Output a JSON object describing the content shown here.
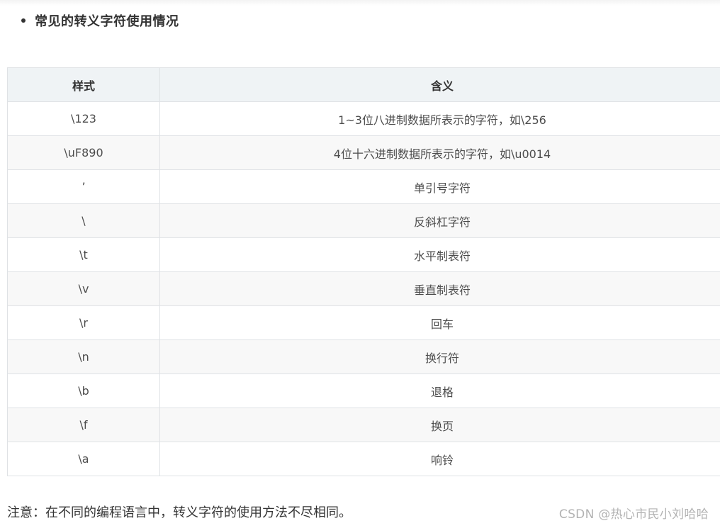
{
  "heading": "常见的转义字符使用情况",
  "table": {
    "headers": [
      "样式",
      "含义"
    ],
    "rows": [
      {
        "style": "\\123",
        "meaning": "1~3位八进制数据所表示的字符，如\\256"
      },
      {
        "style": "\\uF890",
        "meaning": "4位十六进制数据所表示的字符，如\\u0014"
      },
      {
        "style": "’",
        "meaning": "单引号字符"
      },
      {
        "style": "\\",
        "meaning": "反斜杠字符"
      },
      {
        "style": "\\t",
        "meaning": "水平制表符"
      },
      {
        "style": "\\v",
        "meaning": "垂直制表符"
      },
      {
        "style": "\\r",
        "meaning": "回车"
      },
      {
        "style": "\\n",
        "meaning": "换行符"
      },
      {
        "style": "\\b",
        "meaning": "退格"
      },
      {
        "style": "\\f",
        "meaning": "换页"
      },
      {
        "style": "\\a",
        "meaning": "响铃"
      }
    ]
  },
  "note": "注意：在不同的编程语言中，转义字符的使用方法不尽相同。",
  "watermark": "CSDN @热心市民小刘哈哈",
  "colors": {
    "header_bg": "#eff3f5",
    "stripe_bg": "#f8f8f8",
    "border": "#dfe2e5",
    "text": "#333333",
    "watermark": "#b3b3b3"
  }
}
